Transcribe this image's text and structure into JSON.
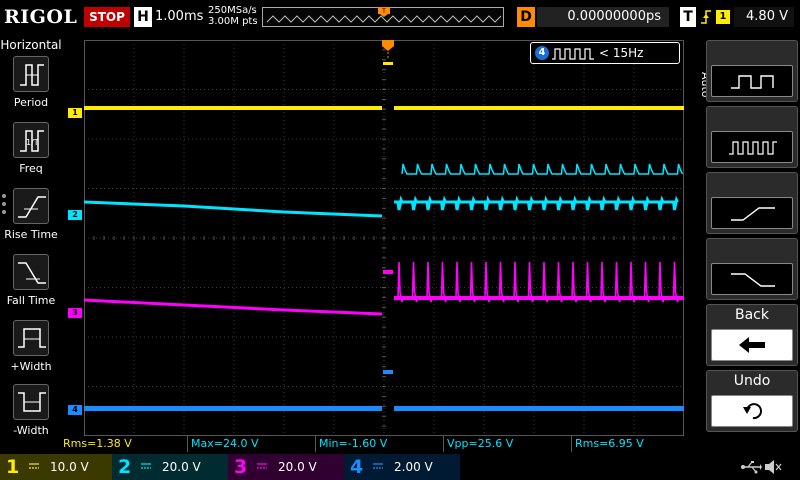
{
  "topbar": {
    "brand": "RIGOL",
    "run_state": "STOP",
    "h_label": "H",
    "timebase": "1.00ms",
    "sample_rate": "250MSa/s",
    "memory_depth": "3.00M pts",
    "d_label": "D",
    "delay": "0.00000000ps",
    "t_label": "T",
    "trigger_source": "1",
    "trigger_level": "4.80 V"
  },
  "sidebar": {
    "title": "Horizontal",
    "items": [
      {
        "label": "Period",
        "icon": "period-icon"
      },
      {
        "label": "Freq",
        "icon": "freq-icon"
      },
      {
        "label": "Rise Time",
        "icon": "rise-time-icon"
      },
      {
        "label": "Fall Time",
        "icon": "fall-time-icon"
      },
      {
        "label": "+Width",
        "icon": "pos-width-icon"
      },
      {
        "label": "-Width",
        "icon": "neg-width-icon"
      }
    ]
  },
  "screen": {
    "markers": [
      "1",
      "2",
      "3",
      "4"
    ],
    "frequency_source": "4",
    "frequency_value": "< 15Hz"
  },
  "softkeys": {
    "mode": "Auto",
    "back_label": "Back",
    "undo_label": "Undo"
  },
  "measurements": [
    {
      "text": "Rms=1.38 V",
      "color": "#ffeb00"
    },
    {
      "text": "Max=24.0 V",
      "color": "#00e5ff"
    },
    {
      "text": "Min=-1.60 V",
      "color": "#00e5ff"
    },
    {
      "text": "Vpp=25.6 V",
      "color": "#00e5ff"
    },
    {
      "text": "Rms=6.95 V",
      "color": "#00e5ff"
    }
  ],
  "channels": [
    {
      "num": "1",
      "scale": "10.0 V",
      "color": "#ffeb00"
    },
    {
      "num": "2",
      "scale": "20.0 V",
      "color": "#00e5ff"
    },
    {
      "num": "3",
      "scale": "20.0 V",
      "color": "#ff00ff"
    },
    {
      "num": "4",
      "scale": "2.00 V",
      "color": "#1a6fd6"
    }
  ],
  "colors": {
    "ch1": "#ffeb00",
    "ch2": "#00e5ff",
    "ch3": "#ff00ff",
    "ch4": "#1a8cff",
    "trigger": "#ff8c00",
    "stop": "#c00000"
  }
}
